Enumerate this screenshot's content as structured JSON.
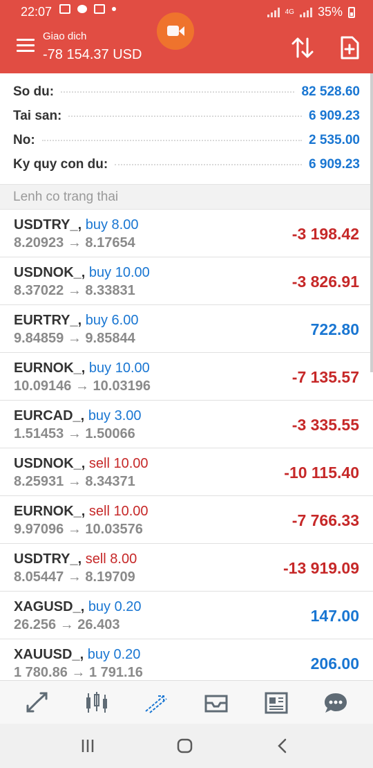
{
  "status_bar": {
    "time": "22:07",
    "network": "4G",
    "battery": "35%"
  },
  "header": {
    "title": "Giao dich",
    "balance": "-78 154.37 USD",
    "icons": [
      "menu-icon",
      "record-icon",
      "sort-icon",
      "new-document-icon"
    ],
    "colors": {
      "bar": "#e14d43",
      "record": "#f0762c"
    }
  },
  "summary": [
    {
      "label": "So du:",
      "value": "82 528.60"
    },
    {
      "label": "Tai san:",
      "value": "6 909.23"
    },
    {
      "label": "No:",
      "value": "2 535.00"
    },
    {
      "label": "Ky quy con du:",
      "value": "6 909.23"
    }
  ],
  "section_title": "Lenh co trang thai",
  "positions": [
    {
      "symbol": "USDTRY_,",
      "side": "buy 8.00",
      "type": "buy",
      "prices": "8.20923 → 8.17654",
      "profit": "-3 198.42"
    },
    {
      "symbol": "USDNOK_,",
      "side": "buy 10.00",
      "type": "buy",
      "prices": "8.37022 → 8.33831",
      "profit": "-3 826.91"
    },
    {
      "symbol": "EURTRY_,",
      "side": "buy 6.00",
      "type": "buy",
      "prices": "9.84859 → 9.85844",
      "profit": "722.80"
    },
    {
      "symbol": "EURNOK_,",
      "side": "buy 10.00",
      "type": "buy",
      "prices": "10.09146 → 10.03196",
      "profit": "-7 135.57"
    },
    {
      "symbol": "EURCAD_,",
      "side": "buy 3.00",
      "type": "buy",
      "prices": "1.51453 → 1.50066",
      "profit": "-3 335.55"
    },
    {
      "symbol": "USDNOK_,",
      "side": "sell 10.00",
      "type": "sell",
      "prices": "8.25931 → 8.34371",
      "profit": "-10 115.40"
    },
    {
      "symbol": "EURNOK_,",
      "side": "sell 10.00",
      "type": "sell",
      "prices": "9.97096 → 10.03576",
      "profit": "-7 766.33"
    },
    {
      "symbol": "USDTRY_,",
      "side": "sell 8.00",
      "type": "sell",
      "prices": "8.05447 → 8.19709",
      "profit": "-13 919.09"
    },
    {
      "symbol": "XAGUSD_,",
      "side": "buy 0.20",
      "type": "buy",
      "prices": "26.256 → 26.403",
      "profit": "147.00"
    },
    {
      "symbol": "XAUUSD_,",
      "side": "buy 0.20",
      "type": "buy",
      "prices": "1 780.86 → 1 791.16",
      "profit": "206.00"
    }
  ],
  "colors": {
    "buy": "#1976d2",
    "sell": "#c62828",
    "positive": "#1976d2",
    "negative": "#c62828"
  },
  "bottom_nav": [
    "quotes-icon",
    "chart-icon",
    "trade-icon",
    "inbox-icon",
    "news-icon",
    "chat-icon"
  ],
  "system_nav": [
    "recent-apps-icon",
    "home-icon",
    "back-icon"
  ]
}
